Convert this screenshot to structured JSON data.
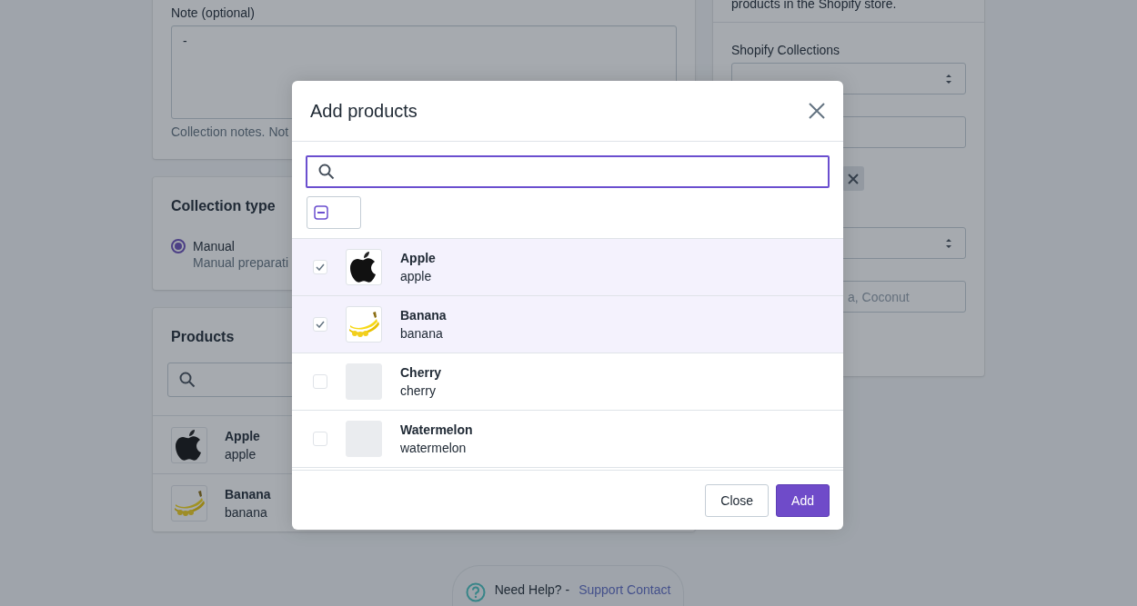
{
  "note_card": {
    "label": "Note (optional)",
    "value": "-",
    "help": "Collection notes. Not"
  },
  "collection_type_card": {
    "title": "Collection type",
    "options": [
      {
        "label": "Manual",
        "description": "Manual preparati",
        "selected": true
      }
    ]
  },
  "products_card": {
    "title": "Products",
    "items": [
      {
        "kind": "apple",
        "name": "Apple",
        "handle": "apple"
      },
      {
        "kind": "banana",
        "name": "Banana",
        "handle": "banana"
      }
    ]
  },
  "shopify_card": {
    "intro": "products in the Shopify store.",
    "label": "Shopify Collections",
    "tags_field_value": "a, Coconut"
  },
  "help": {
    "text": "Need Help? -",
    "link": "Support Contact"
  },
  "modal": {
    "title": "Add products",
    "items": [
      {
        "kind": "apple",
        "name": "Apple",
        "handle": "apple",
        "checked": true
      },
      {
        "kind": "banana",
        "name": "Banana",
        "handle": "banana",
        "checked": true
      },
      {
        "kind": "blank",
        "name": "Cherry",
        "handle": "cherry",
        "checked": false
      },
      {
        "kind": "blank",
        "name": "Watermelon",
        "handle": "watermelon",
        "checked": false
      }
    ],
    "buttons": [
      {
        "kind": "secondary",
        "label": "Close"
      },
      {
        "kind": "primary",
        "label": "Add"
      }
    ]
  }
}
